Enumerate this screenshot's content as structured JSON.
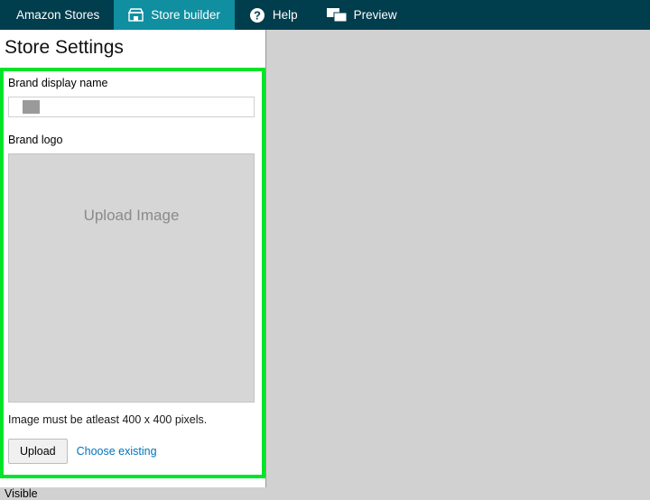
{
  "nav": {
    "amazon_stores": "Amazon Stores",
    "store_builder": "Store builder",
    "help": "Help",
    "preview": "Preview"
  },
  "page": {
    "title": "Store Settings"
  },
  "form": {
    "brand_display_label": "Brand display name",
    "brand_display_value": "",
    "brand_logo_label": "Brand logo",
    "upload_placeholder": "Upload Image",
    "hint": "Image must be atleast 400 x 400 pixels.",
    "upload_btn": "Upload",
    "choose_existing": "Choose existing"
  },
  "visible": {
    "label": "Visible"
  },
  "colors": {
    "nav_bg": "#003d4d",
    "nav_active": "#0f8fa0",
    "highlight_border": "#00e52a",
    "link": "#0073bb"
  }
}
